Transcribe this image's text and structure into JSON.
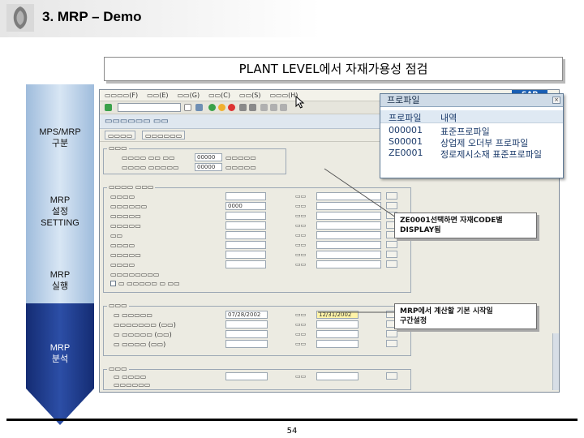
{
  "slide": {
    "title": "3. MRP – Demo",
    "banner": "PLANT LEVEL에서 자재가용성 점검",
    "page_number": "54"
  },
  "process_steps": [
    {
      "label": "MPS/MRP\n구분",
      "state": "inactive"
    },
    {
      "label": "MRP\n설정\nSETTING",
      "state": "inactive"
    },
    {
      "label": "MRP\n실행",
      "state": "inactive"
    },
    {
      "label": "MRP\n분석",
      "state": "active"
    }
  ],
  "sap_window": {
    "logo": "SAP",
    "popup": {
      "title": "프로파일",
      "columns": [
        "프로파일",
        "내역"
      ],
      "rows": [
        {
          "code": "000001",
          "desc": "표준프로파일"
        },
        {
          "code": "S00001",
          "desc": "상업제 오더부 프로파일"
        },
        {
          "code": "ZE0001",
          "desc": "정로제시소재 표준프로파일"
        }
      ]
    }
  },
  "callouts": {
    "profile_note": "ZE0001선택하면 자재CODE별\nDISPLAY됨",
    "period_note": "MRP에서 계산할 기본 시작일\n구간설정"
  },
  "colors": {
    "arrow_light": "#c8d9ec",
    "arrow_dark": "#1f3a8a",
    "sap_bg": "#ecebe2",
    "popup_title": "#cfdbe7"
  }
}
